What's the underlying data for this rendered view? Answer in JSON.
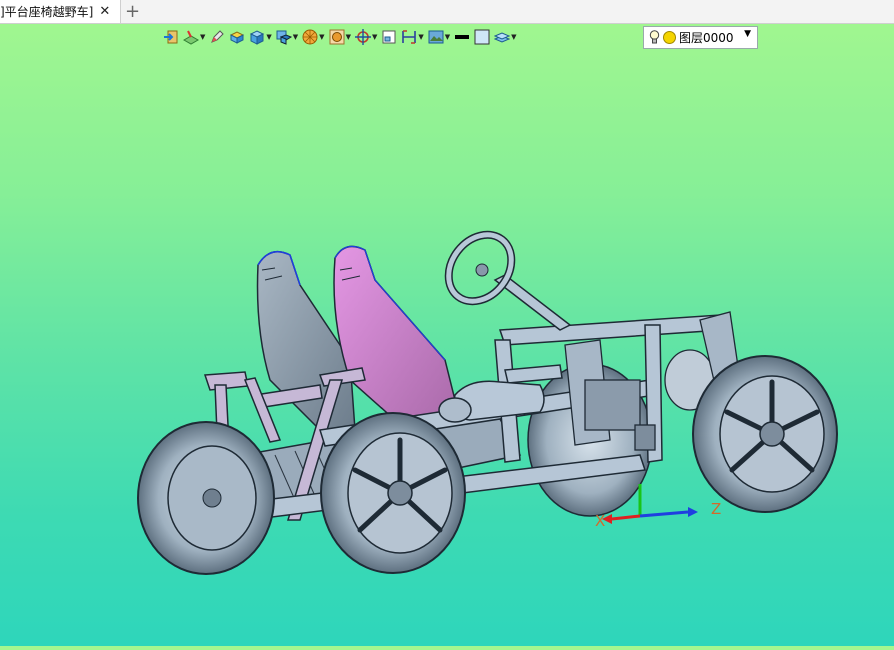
{
  "tab": {
    "title": "]平台座椅越野车]",
    "close_symbol": "✕",
    "add_symbol": "+"
  },
  "toolbar": {
    "buttons": [
      "exit-sketch-icon",
      "sketch-plane-icon",
      "pen-icon",
      "extrude-icon",
      "box-solid-icon",
      "view-cube-icon",
      "render-sphere-icon",
      "display-mode-icon",
      "snap-target-icon",
      "window-icon",
      "dimension-icon",
      "background-icon",
      "line-color-swatch",
      "fill-color-swatch",
      "layer-manager-icon"
    ],
    "layer": {
      "name": "图层0000"
    }
  },
  "axes": {
    "x_label": "X",
    "z_label": "Z"
  },
  "colors": {
    "seat_left": "#7d8ea0",
    "seat_right": "#c87bc8",
    "frame": "#b6c6d6",
    "outline": "#1e2a35",
    "axis_x": "#e02020",
    "axis_y": "#19c419",
    "axis_z": "#1f3fe0"
  }
}
